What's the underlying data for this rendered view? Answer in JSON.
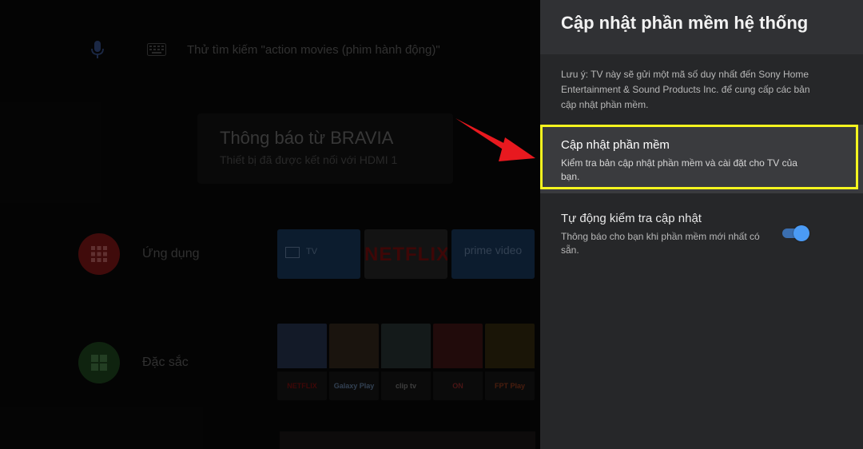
{
  "home": {
    "search_hint": "Thử tìm kiếm \"action movies (phim hành động)\"",
    "notification": {
      "title": "Thông báo từ BRAVIA",
      "subtitle": "Thiết bị đã được kết nối với HDMI 1"
    },
    "rows": [
      {
        "label": "Ứng dụng",
        "icon": "apps-grid-icon",
        "color": "#b22020"
      },
      {
        "label": "Đặc sắc",
        "icon": "featured-grid-icon",
        "color": "#2f6b2f"
      }
    ],
    "app_tiles": [
      {
        "label": "TV",
        "icon": "tv-icon"
      },
      {
        "label": "NETFLIX"
      },
      {
        "label": "prime video"
      }
    ],
    "featured_labels": [
      "NETFLIX",
      "Galaxy Play",
      "clip tv",
      "ON",
      "FPT Play"
    ]
  },
  "panel": {
    "title": "Cập nhật phần mềm hệ thống",
    "note": "Lưu ý: TV này sẽ gửi một mã số duy nhất đến Sony Home Entertainment & Sound Products Inc. để cung cấp các bản cập nhật phần mềm.",
    "options": [
      {
        "title": "Cập nhật phần mềm",
        "description": "Kiểm tra bản cập nhật phần mềm và cài đặt cho TV của bạn."
      },
      {
        "title": "Tự động kiểm tra cập nhật",
        "description": "Thông báo cho bạn khi phần mềm mới nhất có sẵn.",
        "toggle_on": true
      }
    ]
  },
  "colors": {
    "highlight": "#f5f51f",
    "arrow": "#e8191f",
    "toggle": "#4b9bf5"
  }
}
